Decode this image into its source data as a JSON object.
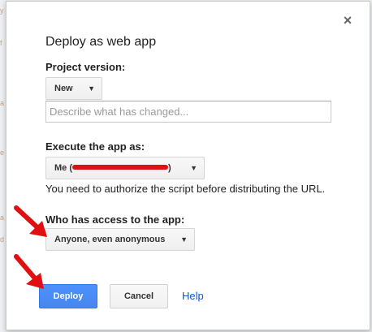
{
  "dialog": {
    "title": "Deploy as web app",
    "close_icon": "×",
    "project_version": {
      "label": "Project version:",
      "selected": "New",
      "description_placeholder": "Describe what has changed..."
    },
    "execute_as": {
      "label": "Execute the app as:",
      "selected_prefix": "Me (",
      "selected_suffix": ")",
      "note": "You need to authorize the script before distributing the URL."
    },
    "access": {
      "label": "Who has access to the app:",
      "selected": "Anyone, even anonymous"
    },
    "buttons": {
      "deploy": "Deploy",
      "cancel": "Cancel",
      "help": "Help"
    },
    "caret": "▼"
  },
  "colors": {
    "primary_button": "#4d90fe",
    "link": "#1155cc",
    "annotation_arrow": "#e01010"
  }
}
